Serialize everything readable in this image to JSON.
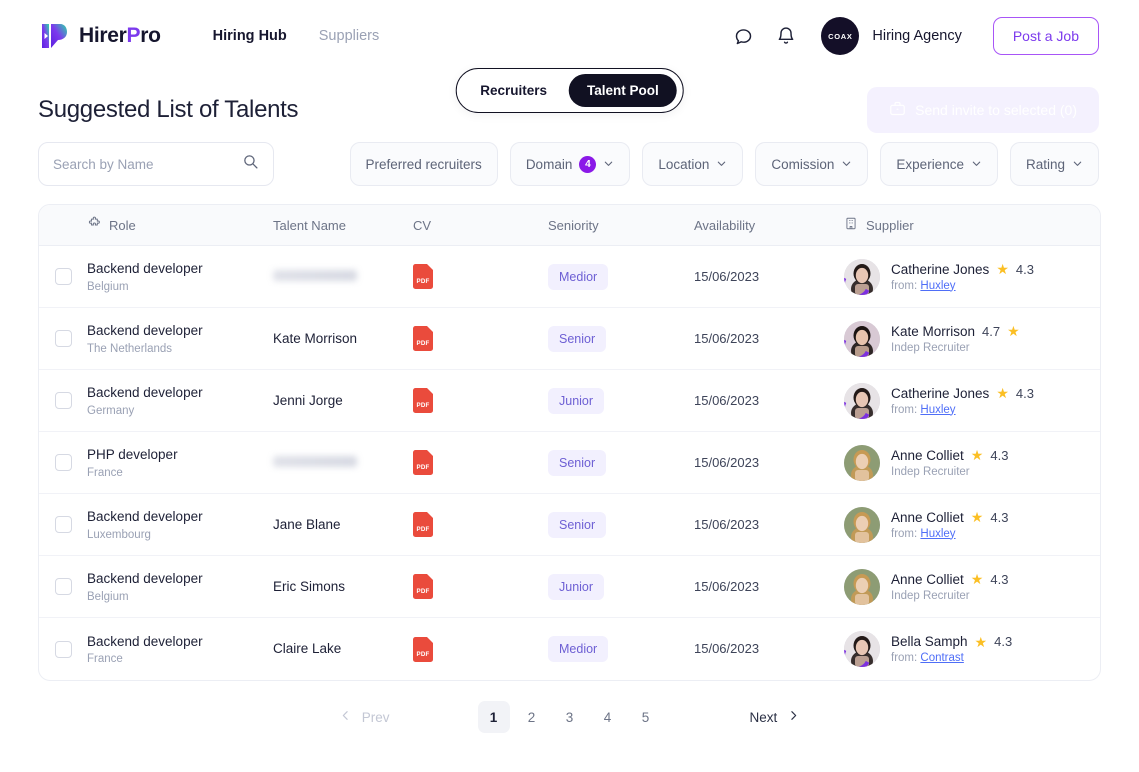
{
  "brand": {
    "name_prefix": "Hirer",
    "name_accent": "P",
    "name_suffix": "ro"
  },
  "nav": {
    "links": [
      {
        "label": "Hiring Hub",
        "active": true
      },
      {
        "label": "Suppliers",
        "active": false
      }
    ],
    "chat_icon": "chat-bubble-icon",
    "bell_icon": "bell-icon",
    "avatar_label": "COAX",
    "agency_name": "Hiring Agency",
    "post_job_label": "Post a Job"
  },
  "segment": {
    "items": [
      {
        "label": "Recruiters",
        "active": false
      },
      {
        "label": "Talent Pool",
        "active": true
      }
    ]
  },
  "page": {
    "title": "Suggested List of Talents",
    "send_invite_label": "Send invite to selected (0)",
    "send_invite_icon": "briefcase-icon"
  },
  "search": {
    "placeholder": "Search by Name",
    "value": "",
    "icon": "search-icon"
  },
  "filters": [
    {
      "label": "Preferred recruiters",
      "badge": null,
      "caret": false
    },
    {
      "label": "Domain",
      "badge": "4",
      "caret": true
    },
    {
      "label": "Location",
      "badge": null,
      "caret": true
    },
    {
      "label": "Comission",
      "badge": null,
      "caret": true
    },
    {
      "label": "Experience",
      "badge": null,
      "caret": true
    },
    {
      "label": "Rating",
      "badge": null,
      "caret": true
    }
  ],
  "table": {
    "columns": {
      "role": "Role",
      "talent_name": "Talent Name",
      "cv": "CV",
      "seniority": "Seniority",
      "availability": "Availability",
      "supplier": "Supplier"
    },
    "role_icon": "puzzle-piece-icon",
    "supplier_icon": "building-icon",
    "cv_label": "PDF",
    "rows": [
      {
        "role": "Backend developer",
        "country": "Belgium",
        "talent_name": "",
        "redacted": true,
        "seniority": "Medior",
        "availability": "15/06/2023",
        "supplier_name": "Catherine Jones",
        "rating": "4.3",
        "rating_before_star": false,
        "supplier_sub_prefix": "from: ",
        "supplier_company": "Huxley"
      },
      {
        "role": "Backend developer",
        "country": "The Netherlands",
        "talent_name": "Kate Morrison",
        "redacted": false,
        "seniority": "Senior",
        "availability": "15/06/2023",
        "supplier_name": "Kate Morrison",
        "rating": "4.7",
        "rating_before_star": true,
        "supplier_sub_prefix": "Indep Recruiter",
        "supplier_company": ""
      },
      {
        "role": "Backend developer",
        "country": "Germany",
        "talent_name": "Jenni Jorge",
        "redacted": false,
        "seniority": "Junior",
        "availability": "15/06/2023",
        "supplier_name": "Catherine Jones",
        "rating": "4.3",
        "rating_before_star": false,
        "supplier_sub_prefix": "from: ",
        "supplier_company": "Huxley"
      },
      {
        "role": "PHP developer",
        "country": "France",
        "talent_name": "",
        "redacted": true,
        "seniority": "Senior",
        "availability": "15/06/2023",
        "supplier_name": "Anne Colliet",
        "rating": "4.3",
        "rating_before_star": false,
        "supplier_sub_prefix": "Indep Recruiter",
        "supplier_company": ""
      },
      {
        "role": "Backend developer",
        "country": "Luxembourg",
        "talent_name": "Jane Blane",
        "redacted": false,
        "seniority": "Senior",
        "availability": "15/06/2023",
        "supplier_name": "Anne Colliet",
        "rating": "4.3",
        "rating_before_star": false,
        "supplier_sub_prefix": "from: ",
        "supplier_company": "Huxley"
      },
      {
        "role": "Backend developer",
        "country": "Belgium",
        "talent_name": "Eric Simons",
        "redacted": false,
        "seniority": "Junior",
        "availability": "15/06/2023",
        "supplier_name": "Anne Colliet",
        "rating": "4.3",
        "rating_before_star": false,
        "supplier_sub_prefix": "Indep Recruiter",
        "supplier_company": ""
      },
      {
        "role": "Backend developer",
        "country": "France",
        "talent_name": "Claire Lake",
        "redacted": false,
        "seniority": "Medior",
        "availability": "15/06/2023",
        "supplier_name": "Bella Samph",
        "rating": "4.3",
        "rating_before_star": false,
        "supplier_sub_prefix": "from: ",
        "supplier_company": "Contrast"
      }
    ]
  },
  "pagination": {
    "prev_label": "Prev",
    "next_label": "Next",
    "pages": [
      "1",
      "2",
      "3",
      "4",
      "5"
    ],
    "current": "1"
  },
  "colors": {
    "accent_purple": "#7c3aed",
    "badge_purple": "#8b19e8",
    "star_yellow": "#fbbf24",
    "pdf_red": "#ea4b3c",
    "link_blue": "#4f6ef7",
    "dark": "#111122"
  }
}
